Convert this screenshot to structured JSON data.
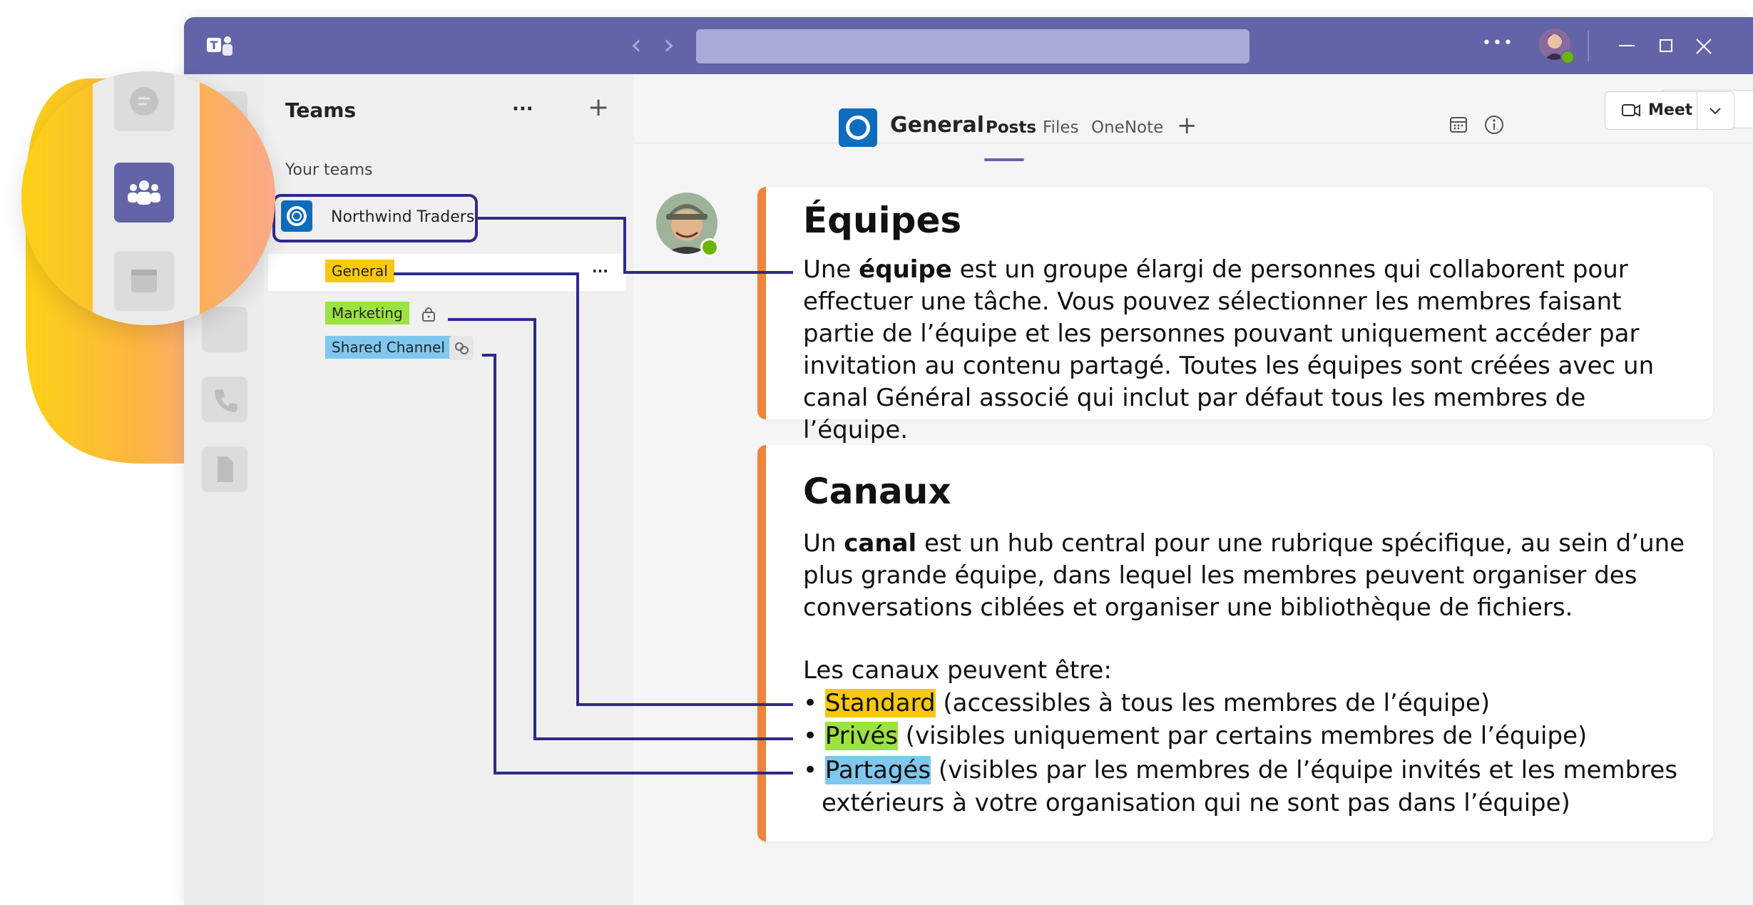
{
  "app": {
    "title_icon": "teams-logo-icon",
    "nav_back": "‹",
    "nav_forward": "›",
    "more_dots": "•••",
    "avatar_icon": "user-avatar-icon"
  },
  "teams_pane": {
    "title": "Teams",
    "more": "···",
    "add": "+",
    "section_label": "Your teams",
    "team_name": "Northwind Traders",
    "channels": [
      {
        "name": "General",
        "more": "···"
      },
      {
        "name": "Marketing",
        "icon": "lock-icon"
      },
      {
        "name": "Shared Channel",
        "icon": "shared-icon"
      }
    ]
  },
  "channel_header": {
    "name": "General",
    "tabs": [
      "Posts",
      "Files",
      "OneNote"
    ],
    "add_tab": "+",
    "meet_label": "Meet"
  },
  "card_teams": {
    "title": "Équipes",
    "p_pre": "Une ",
    "p_bold": "équipe",
    "p_post": " est un groupe élargi de personnes qui collaborent pour effectuer une tâche. Vous pouvez sélectionner les membres faisant partie de l’équipe et les personnes pouvant uniquement accéder par invitation au contenu partagé. Toutes les équipes sont créées avec un canal Général associé qui inclut par défaut tous les membres de l’équipe."
  },
  "card_channels": {
    "title": "Canaux",
    "p_pre": "Un ",
    "p_bold": "canal",
    "p_post": " est un hub central pour une rubrique spécifique, au sein d’une plus grande équipe, dans lequel les membres peuvent organiser des conversations ciblées et organiser une bibliothèque de fichiers.",
    "list_intro": "Les canaux peuvent être:",
    "bullet": "•",
    "items": [
      {
        "term": "Standard",
        "desc": " (accessibles à tous les membres de l’équipe)"
      },
      {
        "term": "Privés",
        "desc": " (visibles uniquement par certains membres de l’équipe)"
      },
      {
        "term": "Partagés",
        "desc": " (visibles par les membres de l’équipe invités et les membres",
        "desc2": "extérieurs à votre organisation qui ne sont pas dans l’équipe)"
      }
    ]
  },
  "colors": {
    "titlebar": "#6264a7",
    "accent_bar": "#f0843a",
    "connector": "#2e2a8c",
    "standard": "#f9c80f",
    "private": "#9be33f",
    "shared": "#7ec8ef"
  }
}
